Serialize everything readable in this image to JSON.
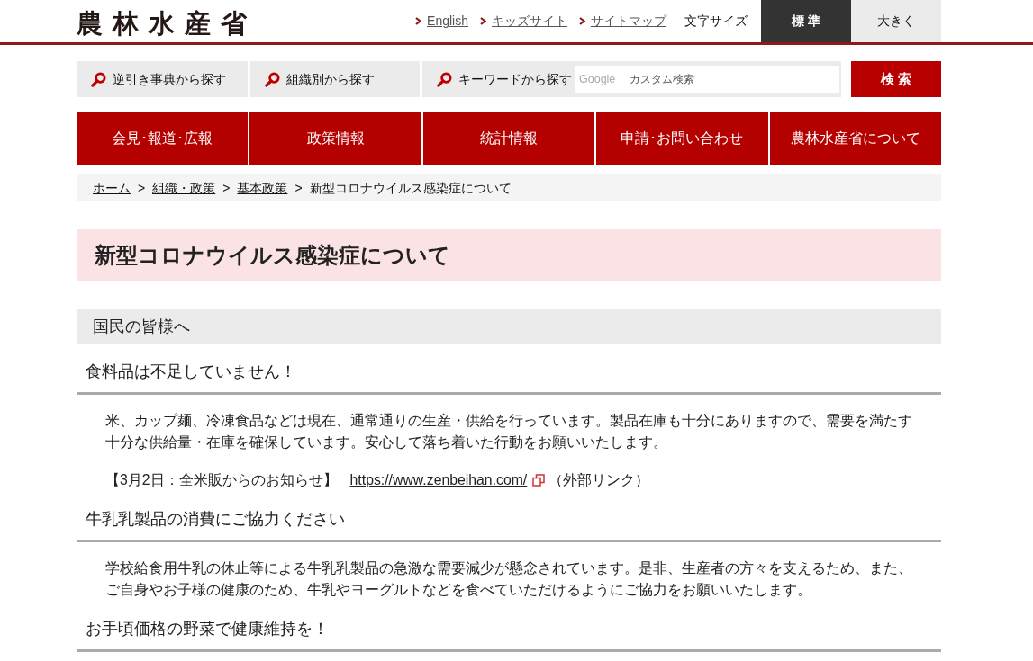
{
  "header": {
    "logo": "農林水産省",
    "links": [
      {
        "label": "English"
      },
      {
        "label": "キッズサイト"
      },
      {
        "label": "サイトマップ"
      }
    ],
    "text_size": {
      "label": "文字サイズ",
      "options": [
        {
          "label": "標 準",
          "selected": true
        },
        {
          "label": "大きく",
          "selected": false
        }
      ]
    }
  },
  "search": {
    "methods": [
      {
        "label": "逆引き事典から探す",
        "kind": "link"
      },
      {
        "label": "組織別から探す",
        "kind": "link"
      },
      {
        "label": "キーワードから探す",
        "kind": "keyword"
      }
    ],
    "field": {
      "brand": "Google",
      "placeholder": "カスタム検索"
    },
    "button": "検 索"
  },
  "nav": [
    {
      "label": "会見･報道･広報"
    },
    {
      "label": "政策情報"
    },
    {
      "label": "統計情報"
    },
    {
      "label": "申請･お問い合わせ"
    },
    {
      "label": "農林水産省について"
    }
  ],
  "breadcrumb": [
    {
      "label": "ホーム",
      "link": true
    },
    {
      "separator": ">",
      "label": "組織・政策",
      "link": true
    },
    {
      "separator": ">",
      "label": "基本政策",
      "link": true
    },
    {
      "separator": ">",
      "label": "新型コロナウイルス感染症について",
      "link": false
    }
  ],
  "page_title": "新型コロナウイルス感染症について",
  "section": {
    "title": "国民の皆様へ",
    "topics": [
      {
        "heading": "食料品は不足していません！",
        "paragraphs": [
          "米、カップ麺、冷凍食品などは現在、通常通りの生産・供給を行っています。製品在庫も十分にありますので、需要を満たす十分な供給量・在庫を確保しています。安心して落ち着いた行動をお願いいたします。"
        ],
        "notice": {
          "prefix": "【3月2日：全米販からのお知らせ】",
          "url": "https://www.zenbeihan.com/",
          "suffix": "（外部リンク）"
        }
      },
      {
        "heading": "牛乳乳製品の消費にご協力ください",
        "paragraphs": [
          "学校給食用牛乳の休止等による牛乳乳製品の急激な需要減少が懸念されています。是非、生産者の方々を支えるため、また、ご自身やお子様の健康のため、牛乳やヨーグルトなどを食べていただけるようにご協力をお願いいたします。"
        ]
      },
      {
        "heading": "お手頃価格の野菜で健康維持を！"
      }
    ]
  }
}
